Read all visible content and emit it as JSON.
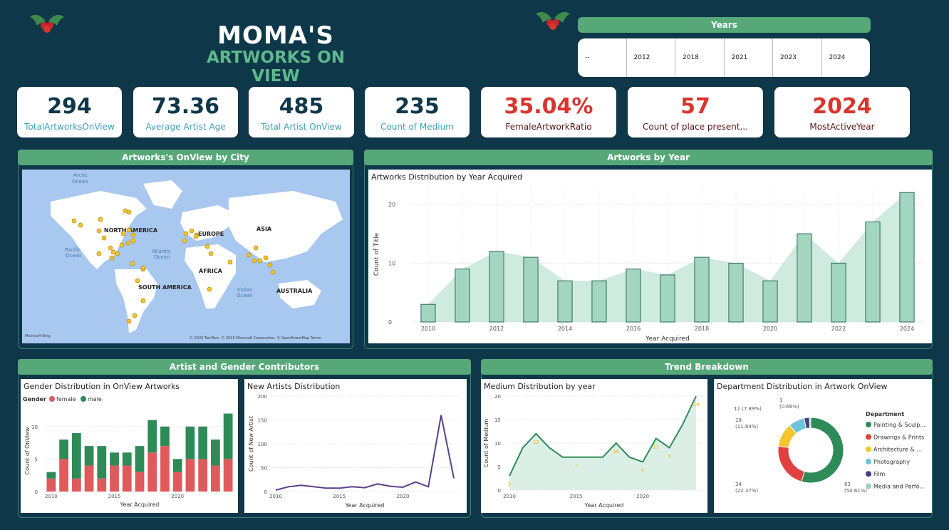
{
  "header": {
    "title_line1": "MOMA'S",
    "title_line2": "ARTWORKS ON VIEW"
  },
  "years_slicer": {
    "label": "Years",
    "options": [
      "--",
      "2012",
      "2018",
      "2021",
      "2023",
      "2024"
    ]
  },
  "kpis": [
    {
      "value": "294",
      "label": "TotalArtworksOnView"
    },
    {
      "value": "73.36",
      "label": "Average Artist Age"
    },
    {
      "value": "485",
      "label": "Total Artist OnView"
    },
    {
      "value": "235",
      "label": "Count of Medium"
    },
    {
      "value": "35.04%",
      "label": "FemaleArtworkRatio"
    },
    {
      "value": "57",
      "label": "Count of place present..."
    },
    {
      "value": "2024",
      "label": "MostActiveYear"
    }
  ],
  "sections": {
    "map": "Artworks's OnView by City",
    "year": "Artworks by Year",
    "artist_gender": "Artist and Gender Contributors",
    "trend": "Trend Breakdown"
  },
  "map": {
    "labels": {
      "arctic": "Arctic\nOcean",
      "north_america": "NORTH AMERICA",
      "europe": "EUROPE",
      "asia": "ASIA",
      "pacific": "Pacific\nOcean",
      "atlantic": "Atlantic\nOcean",
      "africa": "AFRICA",
      "south_america": "SOUTH AMERICA",
      "indian": "Indian\nOcean",
      "australia": "AUSTRALIA"
    },
    "attribution": "© 2025 TomTom, © 2025 Microsoft Corporation, © OpenStreetMap  Terms",
    "logo": "Microsoft Bing",
    "colors": {
      "water": "#a8c8f0",
      "land": "#ffffff",
      "point": "#f2c531"
    }
  },
  "chart_data": [
    {
      "id": "year_chart",
      "type": "bar",
      "title": "Artworks Distribution by Year Acquired",
      "xlabel": "Year Acquired",
      "ylabel": "Count of Title",
      "x": [
        2010,
        2011,
        2012,
        2013,
        2014,
        2015,
        2016,
        2017,
        2018,
        2019,
        2020,
        2021,
        2022,
        2023,
        2024
      ],
      "values": [
        3,
        9,
        12,
        11,
        7,
        7,
        9,
        8,
        11,
        10,
        7,
        15,
        10,
        17,
        22
      ],
      "xticks": [
        "2010",
        "2012",
        "2014",
        "2016",
        "2018",
        "2020",
        "2022",
        "2024"
      ],
      "yticks": [
        "0",
        "10",
        "20"
      ],
      "ylim": [
        0,
        23
      ],
      "color": "#a3d6c1"
    },
    {
      "id": "gender_chart",
      "type": "bar",
      "title": "Gender Distribution in OnView Artworks",
      "legend_title": "Gender",
      "xlabel": "Year Acquired",
      "ylabel": "Count of OnView",
      "x": [
        2010,
        2011,
        2012,
        2013,
        2014,
        2015,
        2016,
        2017,
        2018,
        2019,
        2020,
        2021,
        2022,
        2023,
        2024
      ],
      "series": [
        {
          "name": "female",
          "color": "#e05a5c",
          "values": [
            2,
            5,
            2,
            4,
            2,
            4,
            4,
            3,
            6,
            7,
            3,
            5,
            5,
            4,
            5
          ]
        },
        {
          "name": "male",
          "color": "#2e8b57",
          "values": [
            1,
            3,
            7,
            3,
            5,
            2,
            2,
            4,
            5,
            3,
            2,
            5,
            5,
            4,
            7
          ]
        }
      ],
      "xticks": [
        "2010",
        "2015",
        "2020"
      ],
      "yticks": [
        "0",
        "5",
        "10"
      ],
      "ylim": [
        0,
        12.5
      ]
    },
    {
      "id": "new_artists_chart",
      "type": "line",
      "title": "New Artists Distribution",
      "xlabel": "Year Acquired",
      "ylabel": "Count of New Artist",
      "x": [
        2010,
        2011,
        2012,
        2013,
        2014,
        2015,
        2016,
        2017,
        2018,
        2019,
        2020,
        2021,
        2022,
        2023,
        2024
      ],
      "values": [
        3,
        10,
        13,
        10,
        7,
        7,
        10,
        8,
        16,
        11,
        9,
        20,
        10,
        160,
        28
      ],
      "xticks": [
        "2010",
        "2015",
        "2020"
      ],
      "yticks": [
        "0",
        "50",
        "100",
        "150",
        "200"
      ],
      "ylim": [
        0,
        200
      ],
      "color": "#5a3f8a"
    },
    {
      "id": "medium_chart",
      "type": "area",
      "title": "Medium Distribution by year",
      "xlabel": "Year Acquired",
      "ylabel": "Count of Medium",
      "x": [
        2010,
        2011,
        2012,
        2013,
        2014,
        2015,
        2016,
        2017,
        2018,
        2019,
        2020,
        2021,
        2022,
        2023,
        2024
      ],
      "values": [
        3,
        9,
        12,
        9,
        7,
        7,
        7,
        7,
        10,
        7,
        6,
        11,
        9,
        14,
        20
      ],
      "labels": [
        {
          "x": 2010,
          "y": 3,
          "text": "3"
        },
        {
          "x": 2012,
          "y": 12,
          "text": "12"
        },
        {
          "x": 2015,
          "y": 7,
          "text": "7"
        },
        {
          "x": 2018,
          "y": 10,
          "text": "10"
        },
        {
          "x": 2020,
          "y": 6,
          "text": "6"
        },
        {
          "x": 2021,
          "y": 11,
          "text": "11"
        },
        {
          "x": 2022,
          "y": 9,
          "text": "9"
        },
        {
          "x": 2024,
          "y": 20,
          "text": "20"
        }
      ],
      "xticks": [
        "2010",
        "2015",
        "2020"
      ],
      "yticks": [
        "0",
        "5",
        "10",
        "15",
        "20"
      ],
      "ylim": [
        0,
        20
      ],
      "color": "#2e8b57",
      "fill": "#dcefe6",
      "label_color": "#f2b630"
    },
    {
      "id": "department_chart",
      "type": "pie",
      "title": "Department Distribution in Artwork OnView",
      "legend_title": "Department",
      "slices": [
        {
          "name": "Painting & Sculp...",
          "value": 83,
          "color": "#2e8b57",
          "label": "83\n(54.61%)"
        },
        {
          "name": "Drawings & Prints",
          "value": 34,
          "color": "#e0413f",
          "label": "34\n(22.37%)"
        },
        {
          "name": "Architecture & ...",
          "value": 18,
          "color": "#f2c531",
          "label": "18\n(11.84%)"
        },
        {
          "name": "Photography",
          "value": 12,
          "color": "#6cc4d8",
          "label": "12 (7.89%)"
        },
        {
          "name": "Film",
          "value": 4,
          "color": "#4a3a8a",
          "label": ""
        },
        {
          "name": "Media and Perfo...",
          "value": 1,
          "color": "#9ad3b8",
          "label": "1\n(0.66%)"
        }
      ]
    }
  ]
}
